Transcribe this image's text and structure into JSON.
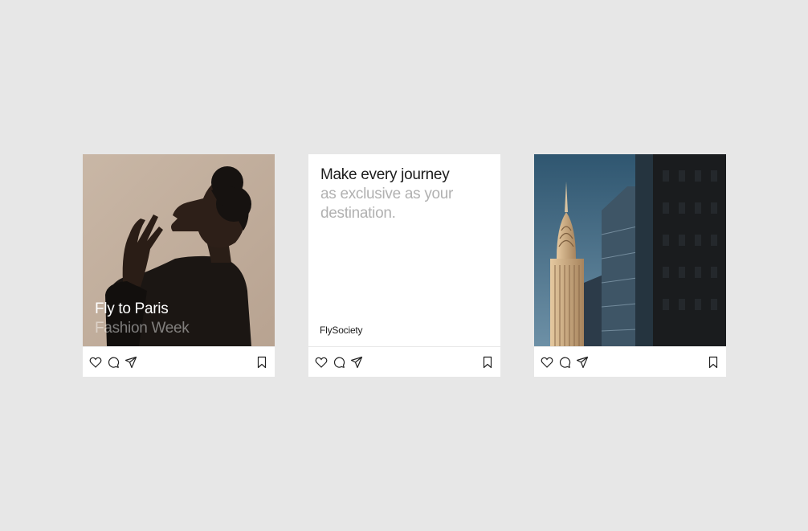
{
  "posts": [
    {
      "image": "woman-profile-photo",
      "overlay_title": "Fly to Paris",
      "overlay_subtitle": "Fashion Week"
    },
    {
      "headline": "Make every journey",
      "subheadline": "as exclusive as your destination.",
      "brand": "FlySociety"
    },
    {
      "image": "chrysler-building-photo"
    }
  ],
  "actions": {
    "icons": [
      "heart-icon",
      "comment-icon",
      "send-icon",
      "bookmark-icon"
    ]
  },
  "colors": {
    "background": "#e7e7e7",
    "card": "#ffffff",
    "headline": "#1c1c1c",
    "subheadline": "#b1b1b1"
  }
}
